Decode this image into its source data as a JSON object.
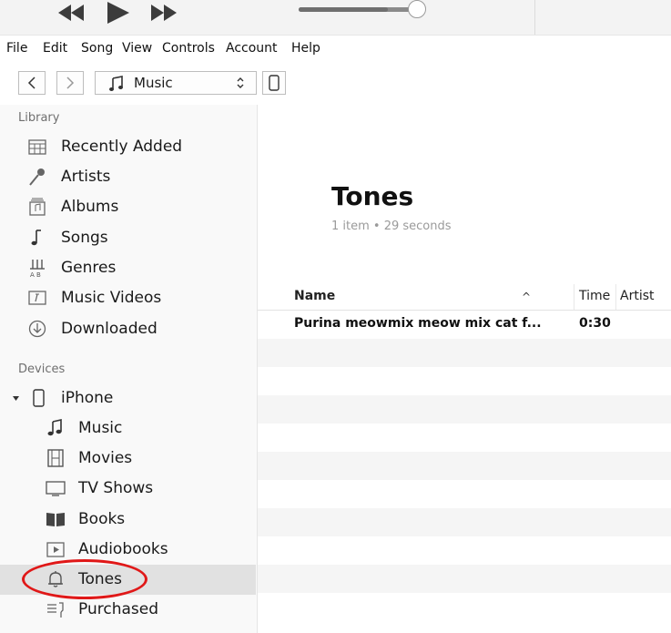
{
  "menu": [
    "File",
    "Edit",
    "Song",
    "View",
    "Controls",
    "Account",
    "Help"
  ],
  "toolbar": {
    "source_label": "Music",
    "playback_progress": 0.75
  },
  "sidebar": {
    "library_label": "Library",
    "library_items": [
      {
        "label": "Recently Added",
        "icon": "calendar-grid-icon"
      },
      {
        "label": "Artists",
        "icon": "microphone-icon"
      },
      {
        "label": "Albums",
        "icon": "album-icon"
      },
      {
        "label": "Songs",
        "icon": "music-note-icon"
      },
      {
        "label": "Genres",
        "icon": "genres-icon"
      },
      {
        "label": "Music Videos",
        "icon": "music-video-icon"
      },
      {
        "label": "Downloaded",
        "icon": "download-circle-icon"
      }
    ],
    "devices_label": "Devices",
    "device": {
      "label": "iPhone",
      "icon": "iphone-icon",
      "expanded": true
    },
    "device_items": [
      {
        "label": "Music",
        "icon": "music-note-icon"
      },
      {
        "label": "Movies",
        "icon": "film-icon"
      },
      {
        "label": "TV Shows",
        "icon": "tv-icon"
      },
      {
        "label": "Books",
        "icon": "book-icon"
      },
      {
        "label": "Audiobooks",
        "icon": "audiobook-icon"
      },
      {
        "label": "Tones",
        "icon": "bell-icon",
        "selected": true
      },
      {
        "label": "Purchased",
        "icon": "purchased-list-icon"
      }
    ]
  },
  "main": {
    "title": "Tones",
    "subtitle": "1 item • 29 seconds",
    "columns": {
      "name": "Name",
      "time": "Time",
      "artist": "Artist"
    },
    "sort_indicator": "^",
    "rows": [
      {
        "name": "Purina meowmix meow mix cat f...",
        "time": "0:30",
        "artist": ""
      }
    ]
  },
  "colors": {
    "annotation": "#e01818",
    "selected_bg": "#e1e1e1",
    "sidebar_bg": "#f9f9f9"
  }
}
